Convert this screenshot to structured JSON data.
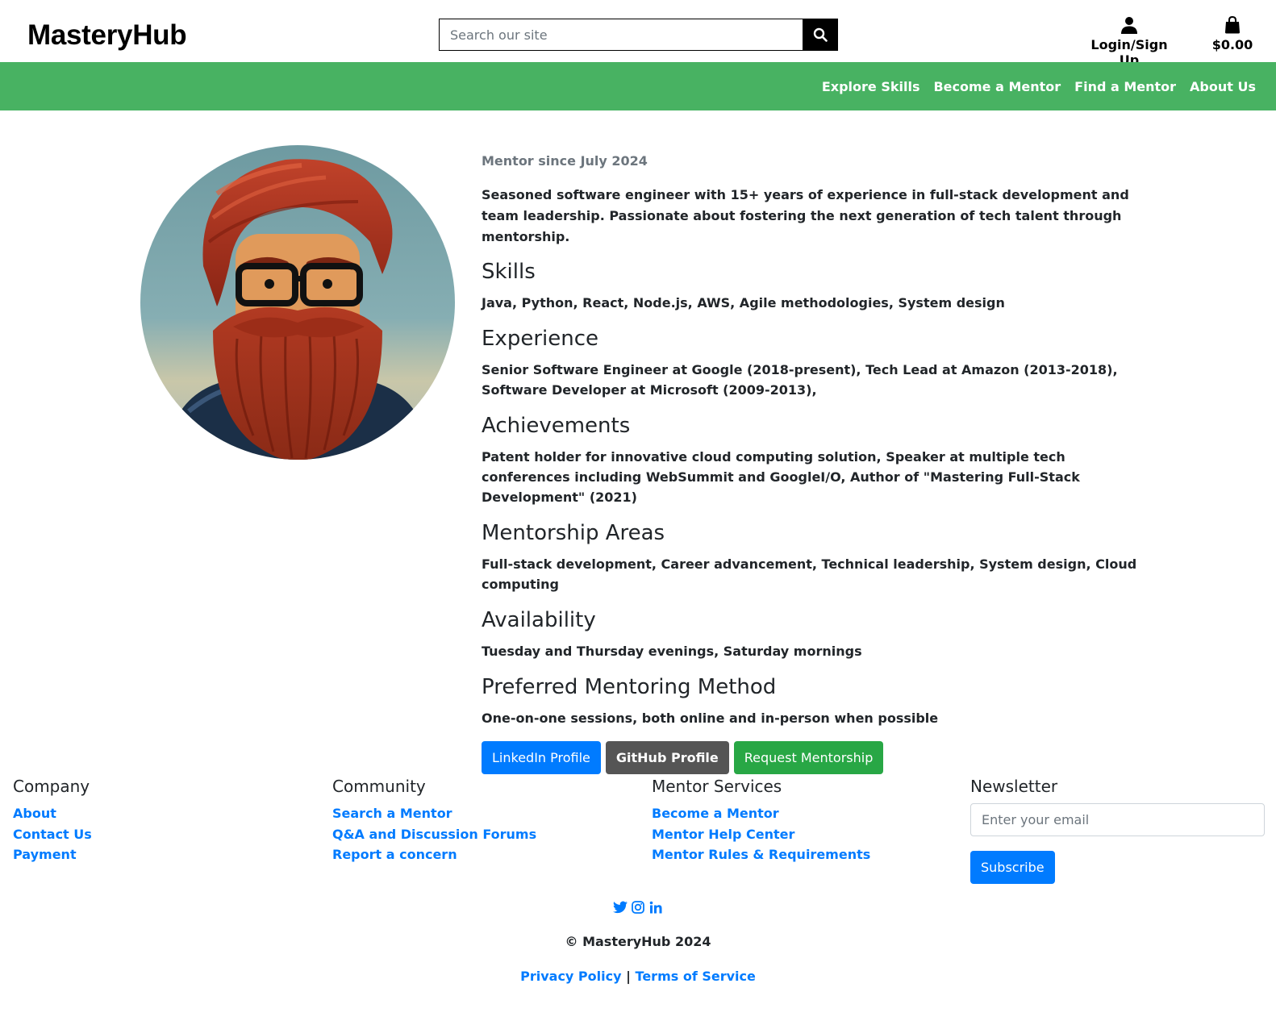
{
  "header": {
    "brand": "MasteryHub",
    "search_placeholder": "Search our site",
    "login_label": "Login/Sign Up",
    "cart_total": "$0.00"
  },
  "nav": {
    "items": [
      "Explore Skills",
      "Become a Mentor",
      "Find a Mentor",
      "About Us"
    ]
  },
  "profile": {
    "mentor_since": "Mentor since July 2024",
    "bio": "Seasoned software engineer with 15+ years of experience in full-stack development and team leadership. Passionate about fostering the next generation of tech talent through mentorship.",
    "sections": [
      {
        "heading": "Skills",
        "text": "Java, Python, React, Node.js, AWS, Agile methodologies, System design"
      },
      {
        "heading": "Experience",
        "text": "Senior Software Engineer at Google (2018-present), Tech Lead at Amazon (2013-2018), Software Developer at Microsoft (2009-2013),"
      },
      {
        "heading": "Achievements",
        "text": "Patent holder for innovative cloud computing solution, Speaker at multiple tech conferences including WebSummit and GoogleI/O, Author of \"Mastering Full-Stack Development\" (2021)"
      },
      {
        "heading": "Mentorship Areas",
        "text": "Full-stack development, Career advancement, Technical leadership, System design, Cloud computing"
      },
      {
        "heading": "Availability",
        "text": "Tuesday and Thursday evenings, Saturday mornings"
      },
      {
        "heading": "Preferred Mentoring Method",
        "text": "One-on-one sessions, both online and in-person when possible"
      }
    ],
    "buttons": {
      "linkedin": "LinkedIn Profile",
      "github": "GitHub Profile",
      "request": "Request Mentorship"
    }
  },
  "footer": {
    "columns": [
      {
        "title": "Company",
        "links": [
          "About",
          "Contact Us",
          "Payment"
        ]
      },
      {
        "title": "Community",
        "links": [
          "Search a Mentor",
          "Q&A and Discussion Forums",
          "Report a concern"
        ]
      },
      {
        "title": "Mentor Services",
        "links": [
          "Become a Mentor",
          "Mentor Help Center",
          "Mentor Rules & Requirements"
        ]
      }
    ],
    "newsletter": {
      "title": "Newsletter",
      "placeholder": "Enter your email",
      "button": "Subscribe"
    },
    "social_icons": [
      "twitter-icon",
      "instagram-icon",
      "linkedin-icon"
    ],
    "copyright": "© MasteryHub 2024",
    "privacy": "Privacy Policy",
    "separator": "|",
    "terms": "Terms of Service"
  },
  "colors": {
    "nav_green": "#48b262",
    "link_blue": "#007bff",
    "button_gray": "#555555",
    "button_green": "#28a745"
  }
}
